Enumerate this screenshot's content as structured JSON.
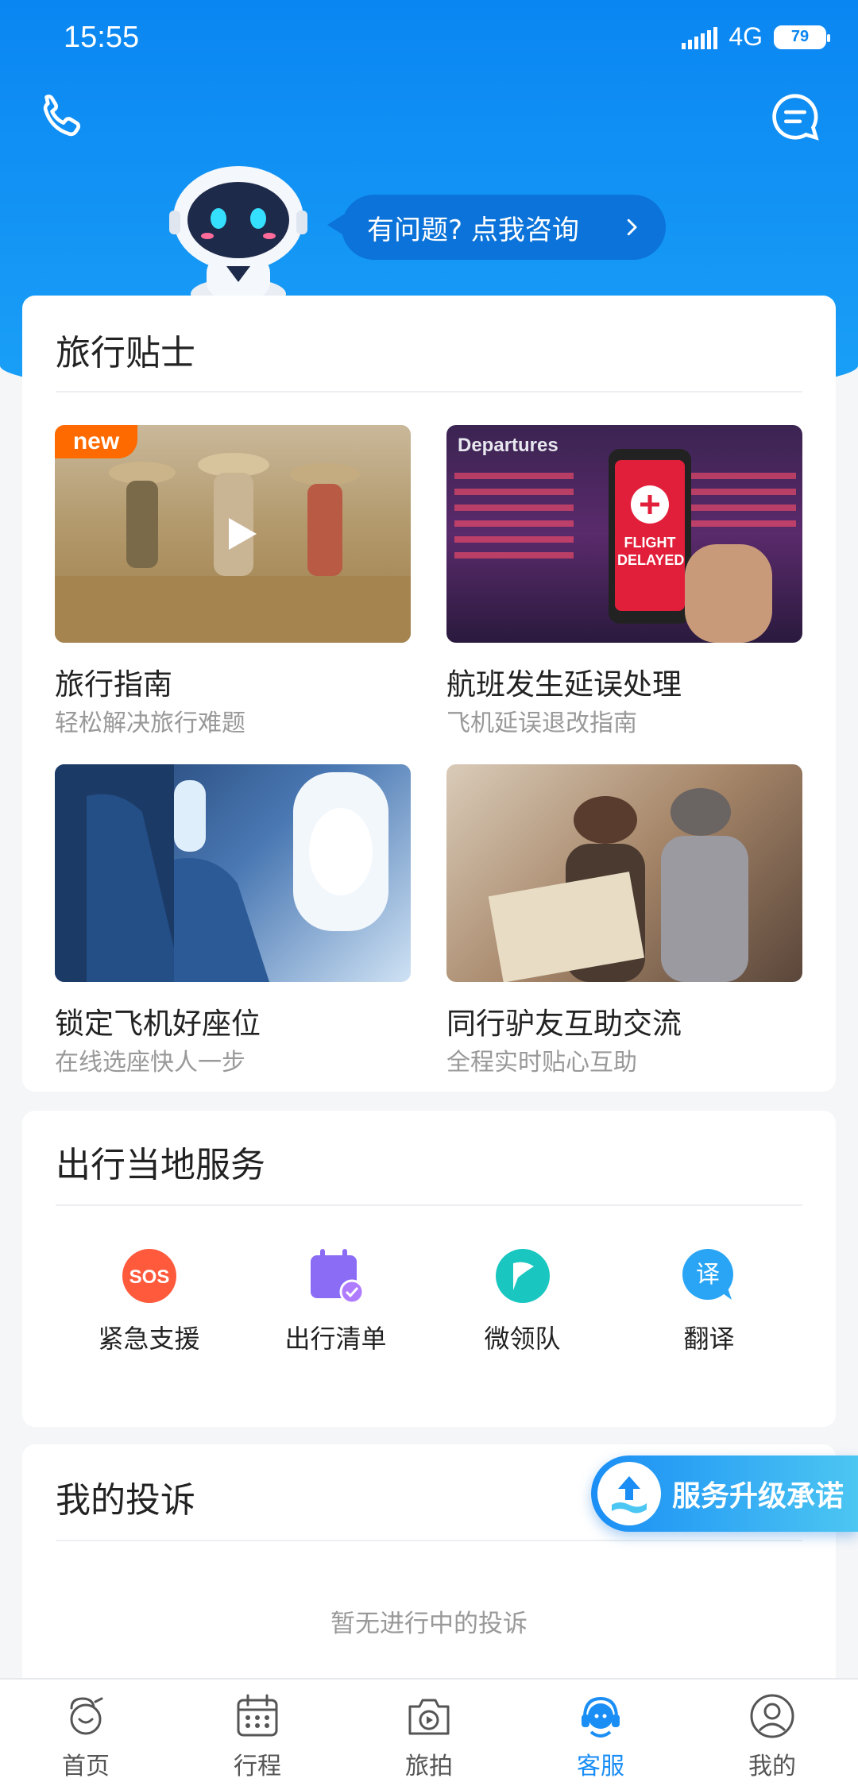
{
  "status_bar": {
    "time": "15:55",
    "network": "4G",
    "battery": "79"
  },
  "assistant": {
    "ask_label": "有问题? 点我咨询"
  },
  "travel_tips": {
    "title": "旅行贴士",
    "items": [
      {
        "title": "旅行指南",
        "subtitle": "轻松解决旅行难题",
        "badge": "new"
      },
      {
        "title": "航班发生延误处理",
        "subtitle": "飞机延误退改指南",
        "image_text_1": "Departures",
        "image_text_2": "FLIGHT",
        "image_text_3": "DELAYED"
      },
      {
        "title": "锁定飞机好座位",
        "subtitle": "在线选座快人一步"
      },
      {
        "title": "同行驴友互助交流",
        "subtitle": "全程实时贴心互助"
      }
    ]
  },
  "local_services": {
    "title": "出行当地服务",
    "items": [
      {
        "label": "紧急支援",
        "icon": "sos-icon",
        "icon_text": "SOS"
      },
      {
        "label": "出行清单",
        "icon": "checklist-icon"
      },
      {
        "label": "微领队",
        "icon": "flag-icon"
      },
      {
        "label": "翻译",
        "icon": "translate-icon",
        "icon_text": "译"
      }
    ]
  },
  "complaints": {
    "title": "我的投诉",
    "empty_text": "暂无进行中的投诉"
  },
  "upgrade_button": {
    "label": "服务升级承诺"
  },
  "tabbar": {
    "items": [
      {
        "label": "首页",
        "icon": "home-icon"
      },
      {
        "label": "行程",
        "icon": "calendar-icon"
      },
      {
        "label": "旅拍",
        "icon": "camera-icon"
      },
      {
        "label": "客服",
        "icon": "support-icon",
        "active": true
      },
      {
        "label": "我的",
        "icon": "profile-icon"
      }
    ]
  },
  "colors": {
    "primary": "#1a8ef5",
    "hero_top": "#0a86f2",
    "badge": "#ff6a00",
    "sos": "#ff5a3c",
    "checklist": "#8b6cf5",
    "flag": "#19c7c0",
    "translate": "#2aa5f5"
  }
}
